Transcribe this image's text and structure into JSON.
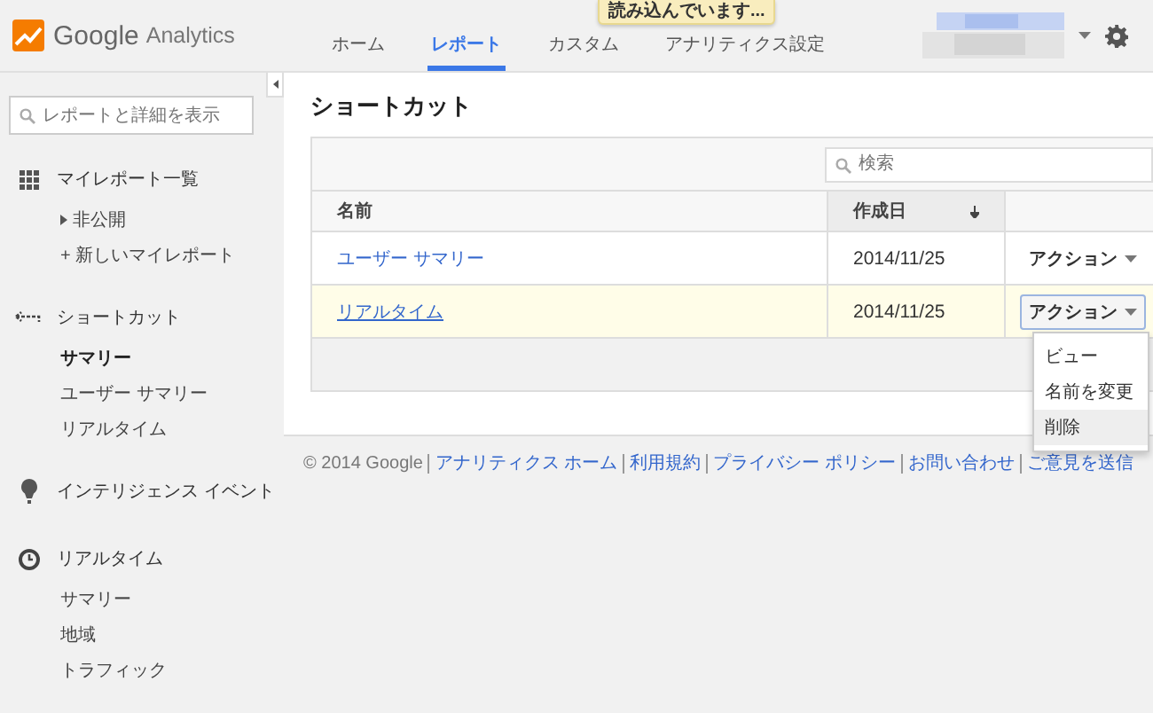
{
  "header": {
    "logo": {
      "brand": "Google",
      "product": "Analytics"
    },
    "tabs": [
      {
        "label": "ホーム",
        "selected": false
      },
      {
        "label": "レポート",
        "selected": true
      },
      {
        "label": "カスタム",
        "selected": false
      },
      {
        "label": "アナリティクス設定",
        "selected": false
      }
    ],
    "loading_toast": "読み込んでいます..."
  },
  "sidebar": {
    "search": {
      "placeholder": "レポートと詳細を表示"
    },
    "sections": [
      {
        "title": "マイレポート一覧",
        "items": [
          {
            "label": "非公開",
            "kind": "collapsible",
            "selected": false
          },
          {
            "label": "+ 新しいマイレポート",
            "kind": "link",
            "selected": false
          }
        ]
      },
      {
        "title": "ショートカット",
        "items": [
          {
            "label": "サマリー",
            "kind": "link",
            "selected": true
          },
          {
            "label": "ユーザー サマリー",
            "kind": "link",
            "selected": false
          },
          {
            "label": "リアルタイム",
            "kind": "link",
            "selected": false
          }
        ]
      },
      {
        "title": "インテリジェンス イベント"
      },
      {
        "title": "リアルタイム",
        "items": [
          {
            "label": "サマリー",
            "kind": "link",
            "selected": false
          },
          {
            "label": "地域",
            "kind": "link",
            "selected": false
          },
          {
            "label": "トラフィック",
            "kind": "link",
            "selected": false
          }
        ]
      }
    ]
  },
  "main": {
    "title": "ショートカット",
    "table": {
      "search": {
        "placeholder": "検索"
      },
      "columns": [
        {
          "label": "名前",
          "sorted": false
        },
        {
          "label": "作成日",
          "sorted": true
        }
      ],
      "rows": [
        {
          "name": "ユーザー サマリー",
          "created": "2014/11/25",
          "action": "アクション",
          "selected": false
        },
        {
          "name": "リアルタイム",
          "created": "2014/11/25",
          "action": "アクション",
          "selected": true
        }
      ],
      "action_menu": [
        {
          "label": "ビュー",
          "selected": false
        },
        {
          "label": "名前を変更",
          "selected": false
        },
        {
          "label": "削除",
          "selected": true
        }
      ]
    }
  },
  "footer": {
    "copyright": "© 2014 Google",
    "links": [
      "アナリティクス ホーム",
      "利用規約",
      "プライバシー ポリシー",
      "お問い合わせ",
      "ご意見を送信"
    ]
  }
}
